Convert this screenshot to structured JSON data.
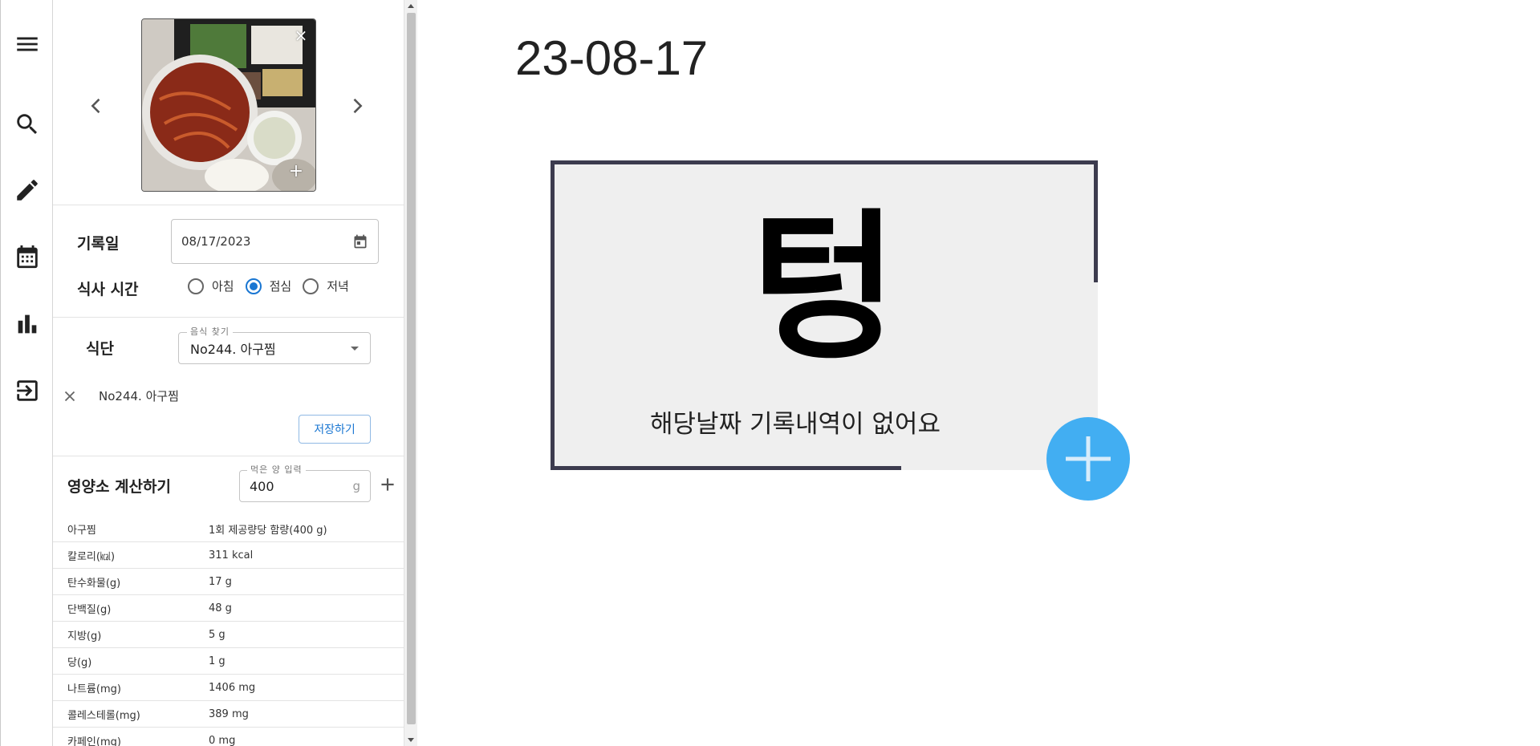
{
  "rail": {
    "icons": [
      "menu-icon",
      "search-icon",
      "pencil-icon",
      "calendar-icon",
      "bar-chart-icon",
      "logout-icon"
    ]
  },
  "photo": {
    "close_glyph": "×",
    "add_glyph": "+",
    "prev_icon": "chevron-left-icon",
    "next_icon": "chevron-right-icon"
  },
  "record": {
    "date_label": "기록일",
    "date_value": "08/17/2023",
    "meal_time_label": "식사 시간",
    "options": [
      "아침",
      "점심",
      "저녁"
    ],
    "selected": "점심"
  },
  "meal": {
    "label": "식단",
    "search_label": "음식 찾기",
    "selected_food": "No244. 아구찜",
    "chip_text": "No244. 아구찜",
    "save_label": "저장하기"
  },
  "nutrition": {
    "title": "영양소 계산하기",
    "amount_label": "먹은 양 입력",
    "amount_value": "400",
    "amount_unit": "g",
    "rows": [
      {
        "k": "아구찜",
        "v": "1회 제공량당 함량(400 g)"
      },
      {
        "k": "칼로리(㎉)",
        "v": "311 kcal"
      },
      {
        "k": "탄수화물(g)",
        "v": "17 g"
      },
      {
        "k": "단백질(g)",
        "v": "48 g"
      },
      {
        "k": "지방(g)",
        "v": "5 g"
      },
      {
        "k": "당(g)",
        "v": "1 g"
      },
      {
        "k": "나트륨(mg)",
        "v": "1406 mg"
      },
      {
        "k": "콜레스테롤(mg)",
        "v": "389 mg"
      },
      {
        "k": "카페인(mg)",
        "v": "0 mg"
      }
    ]
  },
  "main": {
    "date": "23-08-17",
    "glyph": "텅",
    "empty_message": "해당날짜 기록내역이 없어요"
  },
  "colors": {
    "accent": "#1976d2",
    "fab": "#42aef2",
    "card_border": "#3c3b4e",
    "card_bg": "#efefef"
  }
}
